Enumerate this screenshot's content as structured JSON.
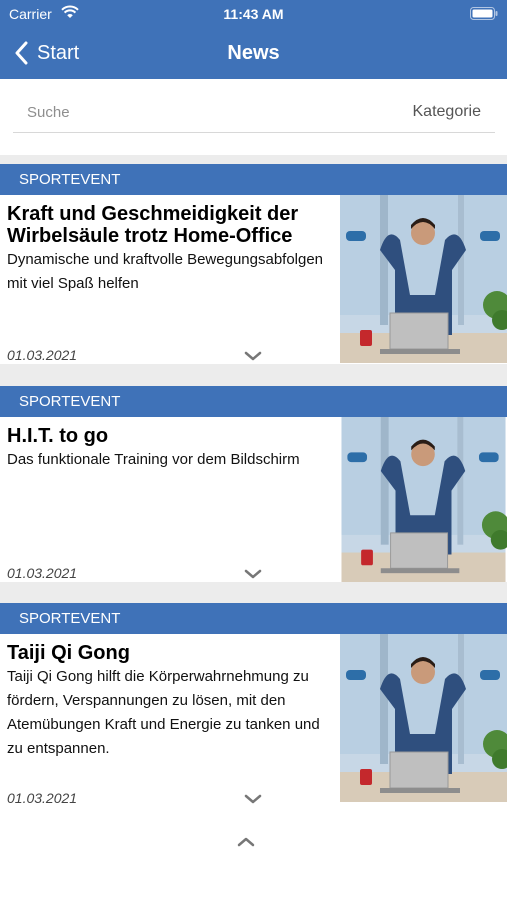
{
  "status_bar": {
    "carrier": "Carrier",
    "time": "11:43 AM"
  },
  "nav": {
    "back_label": "Start",
    "title": "News"
  },
  "search": {
    "placeholder": "Suche",
    "category_label": "Kategorie"
  },
  "articles": [
    {
      "category": "SPORTEVENT",
      "title": "Kraft und Geschmeidigkeit der Wirbelsäule trotz Home-Office",
      "subtitle": "Dynamische und kraftvolle Bewegungsabfolgen mit viel Spaß helfen",
      "date": "01.03.2021"
    },
    {
      "category": "SPORTEVENT",
      "title": "H.I.T. to go",
      "subtitle": "Das funktionale Training vor dem Bildschirm",
      "date": "01.03.2021"
    },
    {
      "category": "SPORTEVENT",
      "title": "Taiji Qi Gong",
      "subtitle": "Taiji Qi Gong hilft die Körperwahrnehmung zu fördern, Verspannungen zu lösen, mit den Atemübungen Kraft und Energie zu tanken und zu entspannen.",
      "date": "01.03.2021"
    }
  ],
  "icons": {
    "wifi": "wifi-icon",
    "battery": "battery-icon",
    "back": "chevron-left-icon",
    "expand": "chevron-down-icon",
    "scroll_top": "chevron-up-icon"
  },
  "colors": {
    "primary": "#3f72b8",
    "separator": "#ececec"
  }
}
